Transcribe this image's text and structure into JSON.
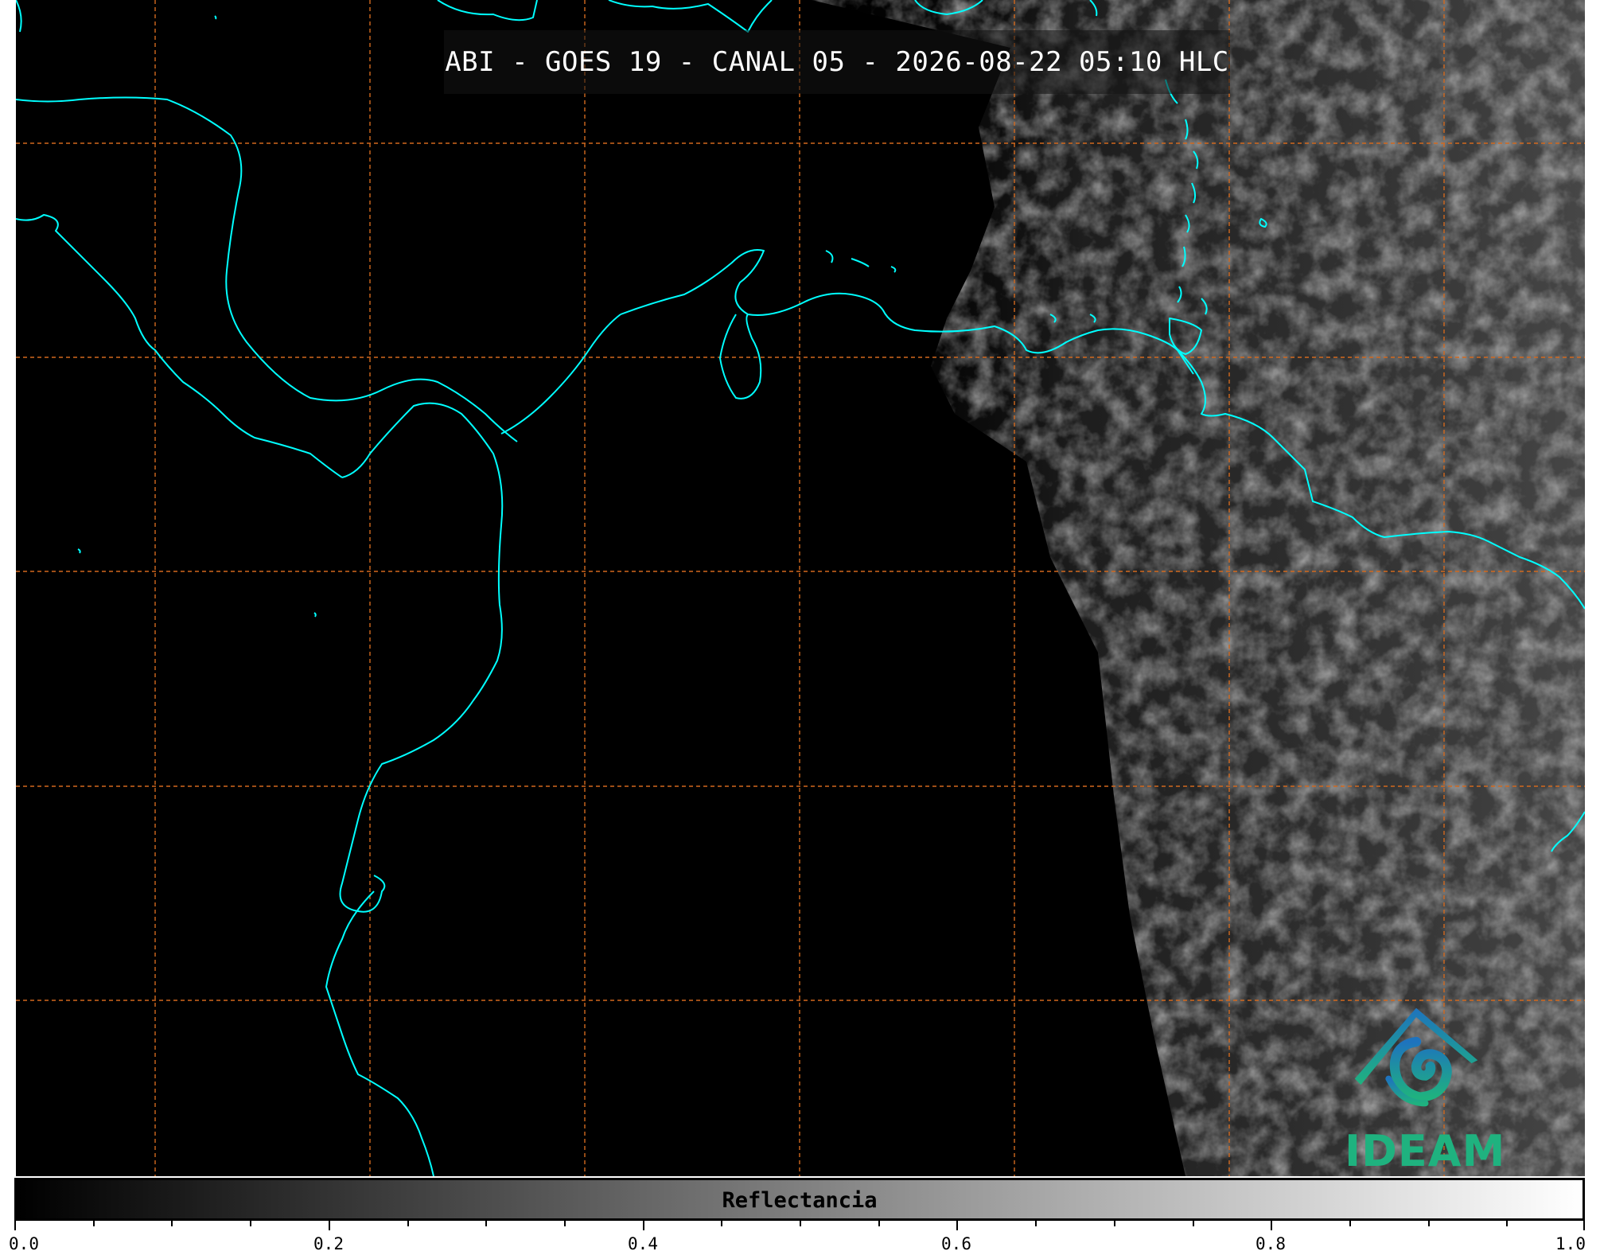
{
  "title": "ABI - GOES 19 - CANAL 05 - 2026-08-22 05:10 HLC",
  "logo": {
    "name": "ideam-logo-icon",
    "text": "IDEAM"
  },
  "colorbar": {
    "label": "Reflectancia",
    "ticks": [
      "0.0",
      "0.2",
      "0.4",
      "0.6",
      "0.8",
      "1.0"
    ],
    "range": [
      0.0,
      1.0
    ],
    "colors": {
      "low": "#000000",
      "high": "#ffffff"
    }
  },
  "colors": {
    "background": "#000000",
    "coastline": "#00ffff",
    "gridlines": "#d2691e",
    "logo_primary": "#1fb27f",
    "logo_secondary": "#1e73be"
  }
}
